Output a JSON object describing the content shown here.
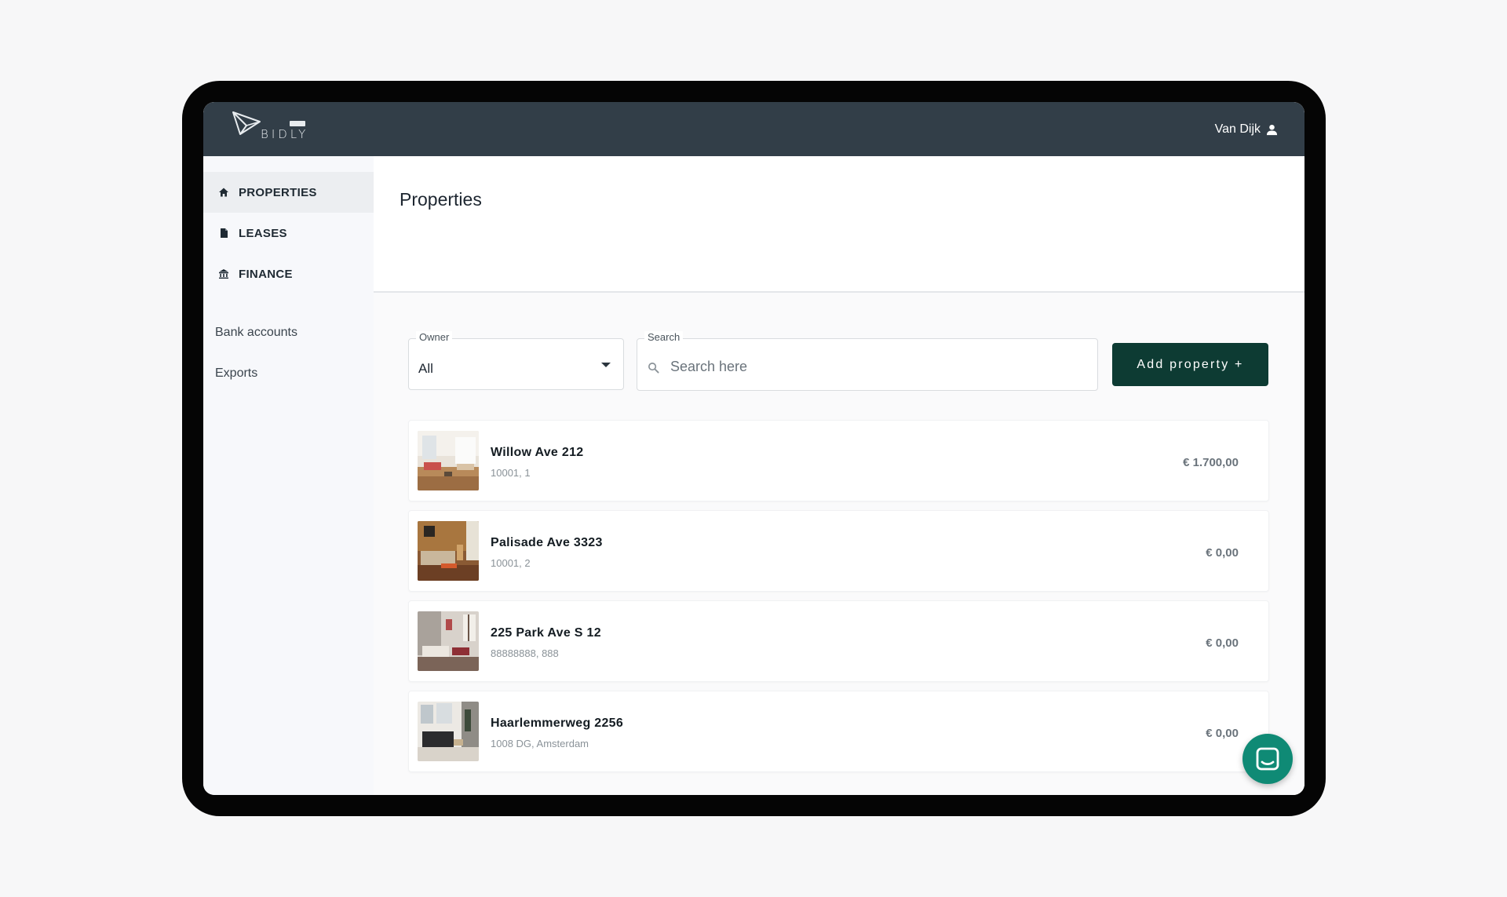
{
  "app": {
    "brand": "BIDLY",
    "user_name": "Van Dijk"
  },
  "sidebar": {
    "nav": [
      {
        "label": "PROPERTIES",
        "icon": "home-icon",
        "active": true
      },
      {
        "label": "LEASES",
        "icon": "document-icon",
        "active": false
      },
      {
        "label": "FINANCE",
        "icon": "bank-icon",
        "active": false
      }
    ],
    "links": [
      "Bank accounts",
      "Exports"
    ]
  },
  "main": {
    "title": "Properties",
    "filters": {
      "owner_label": "Owner",
      "owner_value": "All",
      "search_label": "Search",
      "search_placeholder": "Search here"
    },
    "add_button": "Add property +",
    "properties": [
      {
        "name": "Willow Ave 212",
        "sub": "10001, 1",
        "price": "€ 1.700,00"
      },
      {
        "name": "Palisade Ave 3323",
        "sub": "10001, 2",
        "price": "€ 0,00"
      },
      {
        "name": "225 Park Ave S 12",
        "sub": "88888888, 888",
        "price": "€ 0,00"
      },
      {
        "name": "Haarlemmerweg 2256",
        "sub": "1008 DG, Amsterdam",
        "price": "€ 0,00"
      }
    ]
  },
  "colors": {
    "topbar": "#323e48",
    "primary_button": "#0d3b33",
    "chat_bubble": "#0f8a75"
  }
}
